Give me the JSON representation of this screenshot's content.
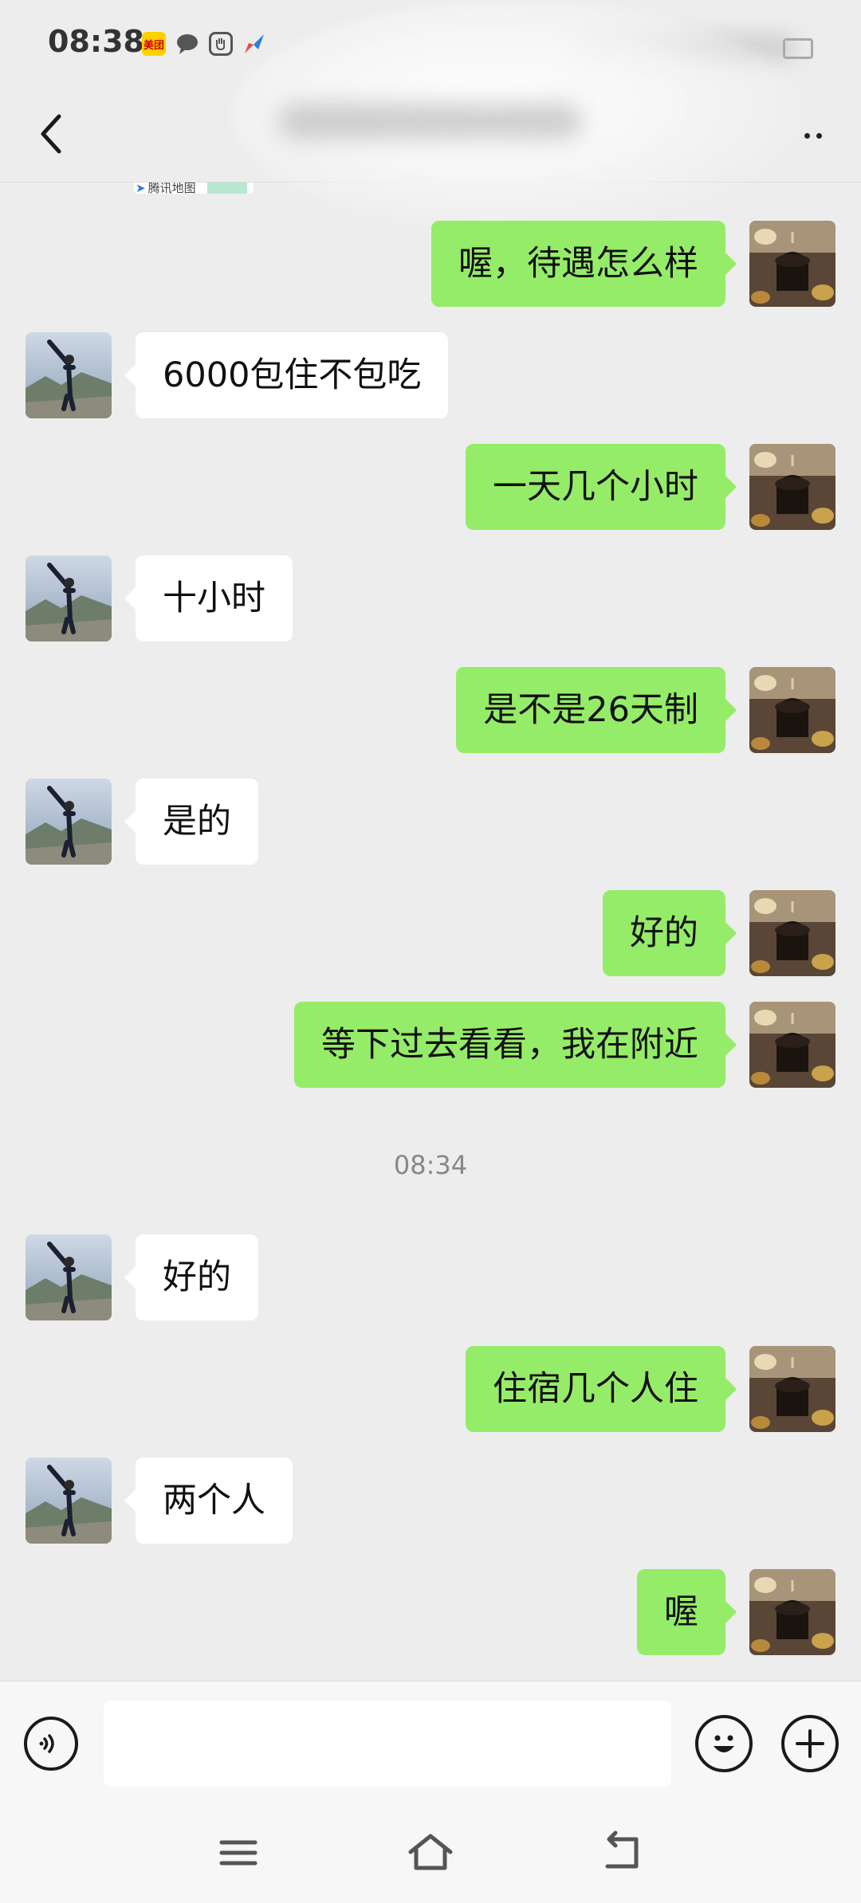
{
  "status_bar": {
    "time": "08:38",
    "icons": [
      "meituan-icon",
      "chat-bubble-icon",
      "hand-icon",
      "airplane-app-icon",
      "battery-icon"
    ],
    "meituan_label": "美团"
  },
  "header": {
    "back_icon": "chevron-left-icon",
    "more_icon": "more-dots-icon"
  },
  "map_attribution": "腾讯地图",
  "messages": [
    {
      "side": "right",
      "text": "喔，待遇怎么样"
    },
    {
      "side": "left",
      "text": "6000包住不包吃"
    },
    {
      "side": "right",
      "text": "一天几个小时"
    },
    {
      "side": "left",
      "text": "十小时"
    },
    {
      "side": "right",
      "text": "是不是26天制"
    },
    {
      "side": "left",
      "text": "是的"
    },
    {
      "side": "right",
      "text": "好的"
    },
    {
      "side": "right",
      "text": "等下过去看看，我在附近"
    },
    {
      "side": "left",
      "text": "好的"
    },
    {
      "side": "right",
      "text": "住宿几个人住"
    },
    {
      "side": "left",
      "text": "两个人"
    },
    {
      "side": "right",
      "text": "喔"
    }
  ],
  "timestamp": "08:34",
  "input_bar": {
    "voice_icon": "voice-icon",
    "input_value": "",
    "emoji_icon": "emoji-icon",
    "plus_icon": "plus-icon"
  },
  "nav_bar": {
    "icons": [
      "menu-icon",
      "home-icon",
      "back-nav-icon"
    ]
  },
  "colors": {
    "background": "#ededed",
    "sent_bubble": "#95ec69",
    "received_bubble": "#ffffff",
    "timestamp_text": "#888888"
  }
}
